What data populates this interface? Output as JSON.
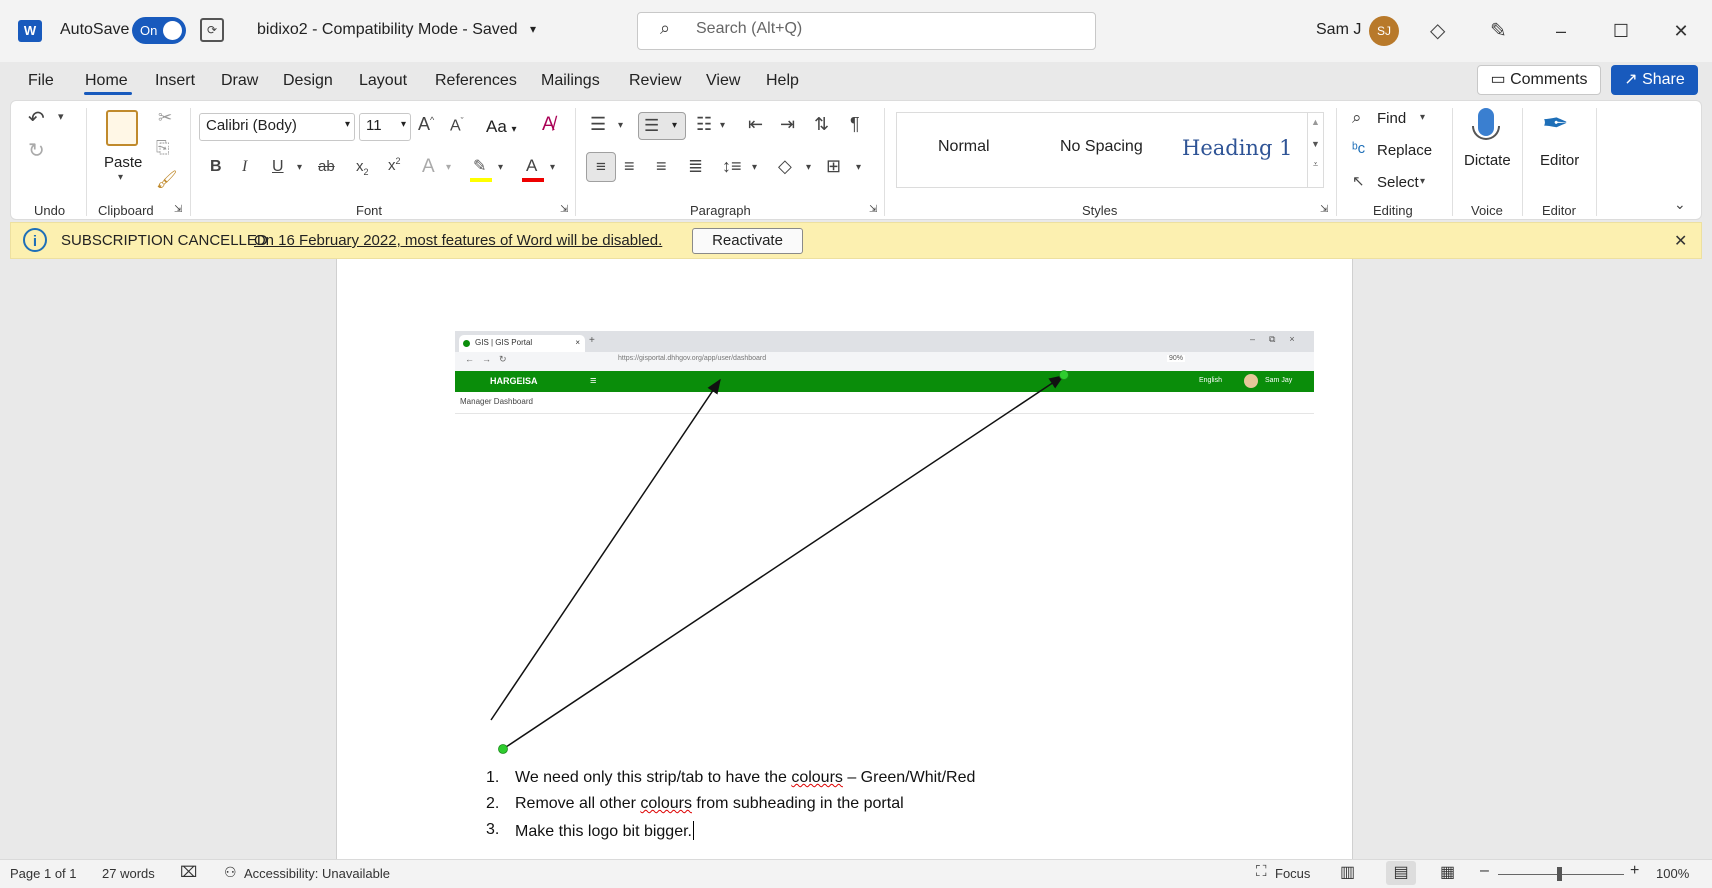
{
  "titlebar": {
    "word_logo": "W",
    "autosave_label": "AutoSave",
    "autosave_state": "On",
    "document_title": "bidixo2  -  Compatibility Mode  -  Saved",
    "search_placeholder": "Search (Alt+Q)",
    "user_name": "Sam J",
    "user_initials": "SJ"
  },
  "ribbon_tabs": [
    "File",
    "Home",
    "Insert",
    "Draw",
    "Design",
    "Layout",
    "References",
    "Mailings",
    "Review",
    "View",
    "Help"
  ],
  "ribbon_actions": {
    "comments": "Comments",
    "share": "Share"
  },
  "ribbon": {
    "font_name": "Calibri (Body)",
    "font_size": "11",
    "case_label": "Aa",
    "paste_label": "Paste",
    "styles": [
      "Normal",
      "No Spacing",
      "Heading 1"
    ],
    "editing": {
      "find": "Find",
      "replace": "Replace",
      "select": "Select"
    },
    "dictate_label": "Dictate",
    "editor_label": "Editor",
    "groups": {
      "undo": "Undo",
      "clipboard": "Clipboard",
      "font": "Font",
      "paragraph": "Paragraph",
      "styles": "Styles",
      "editing": "Editing",
      "voice": "Voice",
      "editor": "Editor"
    }
  },
  "subscription": {
    "title": "SUBSCRIPTION CANCELLED",
    "message": "On 16 February 2022, most features of Word will be disabled.",
    "button": "Reactivate"
  },
  "embedded_screenshot": {
    "tab_title": "GIS | GIS Portal",
    "url": "https://gisportal.dhhgov.org/app/user/dashboard",
    "zoom": "90%",
    "brand": "HARGEISA",
    "language": "English",
    "user": "Sam Jay",
    "subheading": "Manager Dashboard"
  },
  "list_items": [
    {
      "num": "1.",
      "before": "We need only this strip/tab to have the ",
      "misspelled": "colours",
      "after": " – Green/Whit/Red"
    },
    {
      "num": "2.",
      "before": "Remove all other ",
      "misspelled": "colours",
      "after": " from subheading in the portal"
    },
    {
      "num": "3.",
      "before": "Make this logo bit bigger.",
      "misspelled": "",
      "after": ""
    }
  ],
  "statusbar": {
    "page": "Page 1 of 1",
    "words": "27 words",
    "accessibility": "Accessibility: Unavailable",
    "focus": "Focus",
    "zoom": "100%"
  },
  "colors": {
    "brand_blue": "#185abd",
    "banner_yellow": "#fcf0b0",
    "portal_green": "#0a8d0a"
  }
}
